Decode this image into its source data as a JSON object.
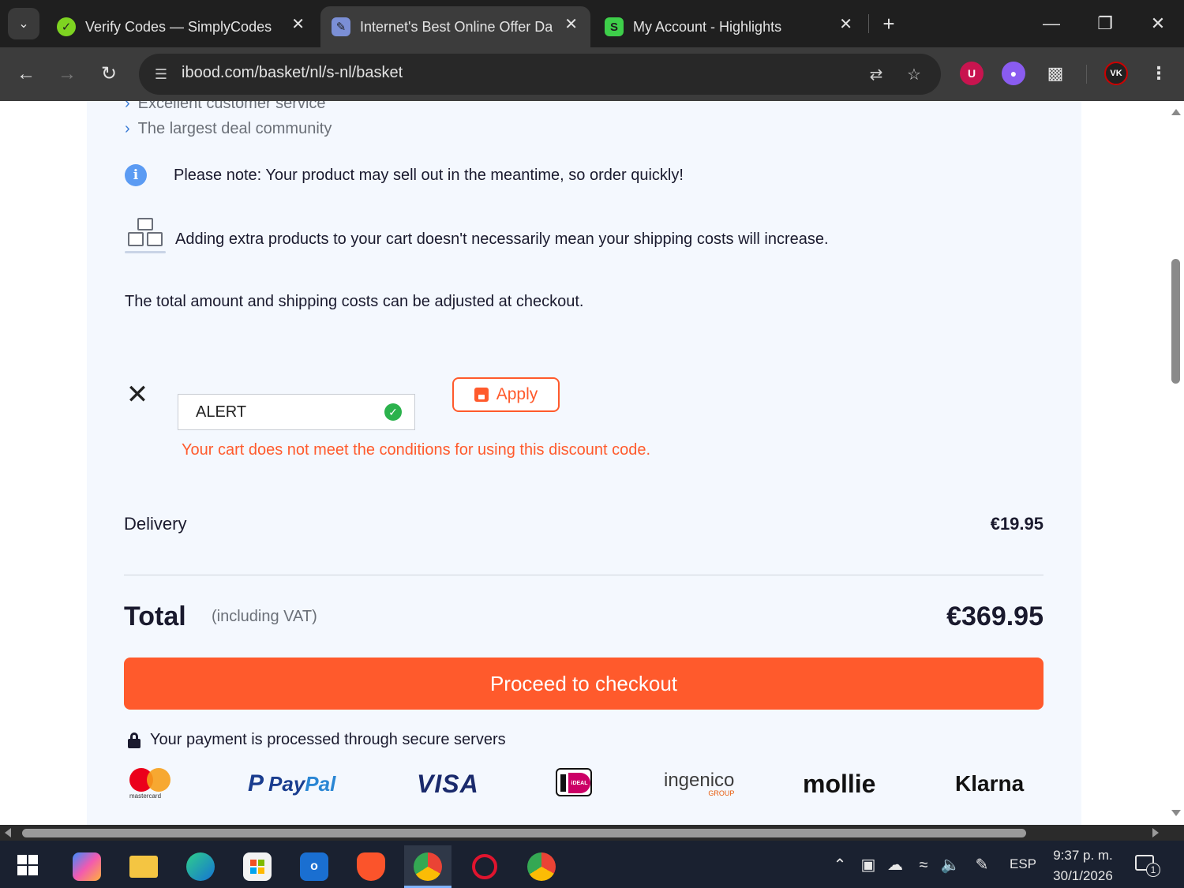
{
  "browser": {
    "tabs": [
      {
        "title": "Verify Codes — SimplyCodes",
        "active": false
      },
      {
        "title": "Internet's Best Online Offer Dail",
        "active": true
      },
      {
        "title": "My Account - Highlights",
        "active": false
      }
    ],
    "url": "ibood.com/basket/nl/s-nl/basket"
  },
  "page": {
    "usps": [
      "Excellent customer service",
      "The largest deal community"
    ],
    "note": "Please note: Your product may sell out in the meantime, so order quickly!",
    "shipping_note": "Adding extra products to your cart doesn't necessarily mean your shipping costs will increase.",
    "adjust_note": "The total amount and shipping costs can be adjusted at checkout.",
    "discount": {
      "code_value": "ALERT",
      "apply_label": "Apply",
      "error": "Your cart does not meet the conditions for using this discount code."
    },
    "delivery": {
      "label": "Delivery",
      "price": "€19.95"
    },
    "total": {
      "label": "Total",
      "vat_note": "(including VAT)",
      "price": "€369.95"
    },
    "checkout_label": "Proceed to checkout",
    "secure_note": "Your payment is processed through secure servers",
    "payment_logos": {
      "mastercard": "mastercard",
      "paypal_a": "Pay",
      "paypal_b": "Pal",
      "visa": "VISA",
      "ideal": "iDEAL",
      "ingenico": "ingenico",
      "ingenico_sub": "GROUP",
      "mollie": "mollie",
      "klarna": "Klarna"
    }
  },
  "taskbar": {
    "language": "ESP",
    "time": "9:37 p. m.",
    "date": "30/1/2026",
    "notification_count": "1"
  },
  "colors": {
    "accent": "#ff5a2c",
    "panel_bg": "#f4f8fe",
    "text": "#1a1a2e",
    "success": "#2bb24c"
  }
}
